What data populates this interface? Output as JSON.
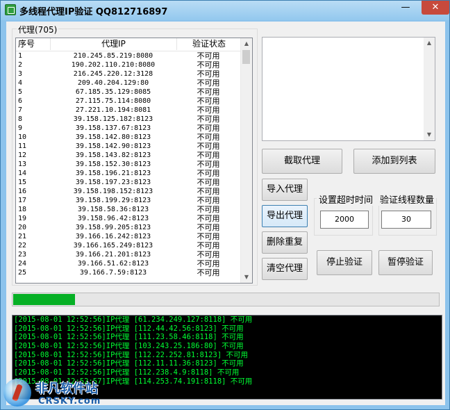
{
  "window": {
    "title": "多线程代理IP验证 QQ812716897",
    "min_glyph": "—",
    "max_glyph": "□",
    "close_glyph": "✕"
  },
  "proxy_group": {
    "label": "代理(705)",
    "columns": [
      "序号",
      "代理IP",
      "验证状态"
    ],
    "rows": [
      [
        "1",
        "210.245.85.219:8080",
        "不可用"
      ],
      [
        "2",
        "190.202.110.210:8080",
        "不可用"
      ],
      [
        "3",
        "216.245.220.12:3128",
        "不可用"
      ],
      [
        "4",
        "209.40.204.129:80",
        "不可用"
      ],
      [
        "5",
        "67.185.35.129:8085",
        "不可用"
      ],
      [
        "6",
        "27.115.75.114:8080",
        "不可用"
      ],
      [
        "7",
        "27.221.10.194:8081",
        "不可用"
      ],
      [
        "8",
        "39.158.125.182:8123",
        "不可用"
      ],
      [
        "9",
        "39.158.137.67:8123",
        "不可用"
      ],
      [
        "10",
        "39.158.142.80:8123",
        "不可用"
      ],
      [
        "11",
        "39.158.142.90:8123",
        "不可用"
      ],
      [
        "12",
        "39.158.143.82:8123",
        "不可用"
      ],
      [
        "13",
        "39.158.152.30:8123",
        "不可用"
      ],
      [
        "14",
        "39.158.196.21:8123",
        "不可用"
      ],
      [
        "15",
        "39.158.197.23:8123",
        "不可用"
      ],
      [
        "16",
        "39.158.198.152:8123",
        "不可用"
      ],
      [
        "17",
        "39.158.199.29:8123",
        "不可用"
      ],
      [
        "18",
        "39.158.58.36:8123",
        "不可用"
      ],
      [
        "19",
        "39.158.96.42:8123",
        "不可用"
      ],
      [
        "20",
        "39.158.99.205:8123",
        "不可用"
      ],
      [
        "21",
        "39.166.16.242:8123",
        "不可用"
      ],
      [
        "22",
        "39.166.165.249:8123",
        "不可用"
      ],
      [
        "23",
        "39.166.21.201:8123",
        "不可用"
      ],
      [
        "24",
        "39.166.51.62:8123",
        "不可用"
      ],
      [
        "25",
        "39.166.7.59:8123",
        "不可用"
      ]
    ]
  },
  "buttons": {
    "fetch": "截取代理",
    "add_to_list": "添加到列表",
    "import": "导入代理",
    "export": "导出代理",
    "dedupe": "删除重复",
    "clear": "清空代理",
    "stop": "停止验证",
    "pause": "暂停验证"
  },
  "timeout": {
    "label": "设置超时时间",
    "value": "2000"
  },
  "threads": {
    "label": "验证线程数量",
    "value": "30"
  },
  "progress": {
    "fraction": 0.145
  },
  "log_lines": [
    "[2015-08-01 12:52:56]IP代理 [61.234.249.127:8118] 不可用",
    "[2015-08-01 12:52:56]IP代理 [112.44.42.56:8123] 不可用",
    "[2015-08-01 12:52:56]IP代理 [111.23.58.46:8118] 不可用",
    "[2015-08-01 12:52:56]IP代理 [103.243.25.186:80] 不可用",
    "[2015-08-01 12:52:56]IP代理 [112.22.252.81:8123] 不可用",
    "[2015-08-01 12:52:56]IP代理 [112.11.11.36:8123] 不可用",
    "[2015-08-01 12:52:56]IP代理 [112.238.4.9:8118] 不可用",
    "[2015-08-01 12:52:57]IP代理 [114.253.74.191:8118] 不可用"
  ],
  "watermark": {
    "cn": "非凡软件站",
    "en": "CRSKY.com"
  }
}
